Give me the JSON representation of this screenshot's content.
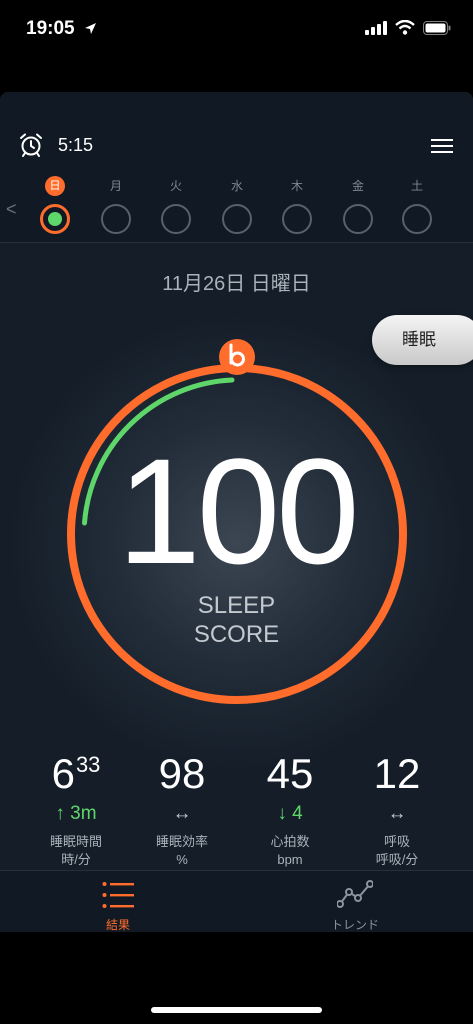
{
  "status": {
    "time": "19:05",
    "icons": [
      "location-arrow-icon",
      "signal-icon",
      "wifi-icon",
      "battery-icon"
    ]
  },
  "header": {
    "alarm_time": "5:15",
    "icons": [
      "alarm-clock-icon",
      "menu-icon"
    ]
  },
  "week": {
    "back": "<",
    "days": [
      {
        "label": "日",
        "selected": true
      },
      {
        "label": "月",
        "selected": false
      },
      {
        "label": "火",
        "selected": false
      },
      {
        "label": "水",
        "selected": false
      },
      {
        "label": "木",
        "selected": false
      },
      {
        "label": "金",
        "selected": false
      },
      {
        "label": "土",
        "selected": false
      }
    ]
  },
  "main": {
    "date": "11月26日 日曜日",
    "sleep_tab": "睡眠",
    "score": "100",
    "score_label_1": "SLEEP",
    "score_label_2": "SCORE",
    "ring_progress": 1.0
  },
  "stats": [
    {
      "value": "6",
      "sup": "33",
      "change": "↑ 3m",
      "trend": "up",
      "label1": "睡眠時間",
      "label2": "時/分"
    },
    {
      "value": "98",
      "sup": "",
      "change": "↔",
      "trend": "flat",
      "label1": "睡眠効率",
      "label2": "%"
    },
    {
      "value": "45",
      "sup": "",
      "change": "↓ 4",
      "trend": "down",
      "label1": "心拍数",
      "label2": "bpm"
    },
    {
      "value": "12",
      "sup": "",
      "change": "↔",
      "trend": "flat",
      "label1": "呼吸",
      "label2": "呼吸/分"
    }
  ],
  "tabs": {
    "results": "結果",
    "trends": "トレンド"
  },
  "colors": {
    "accent": "#ff6c2c",
    "positive": "#5fd66a",
    "background": "#141d28"
  }
}
